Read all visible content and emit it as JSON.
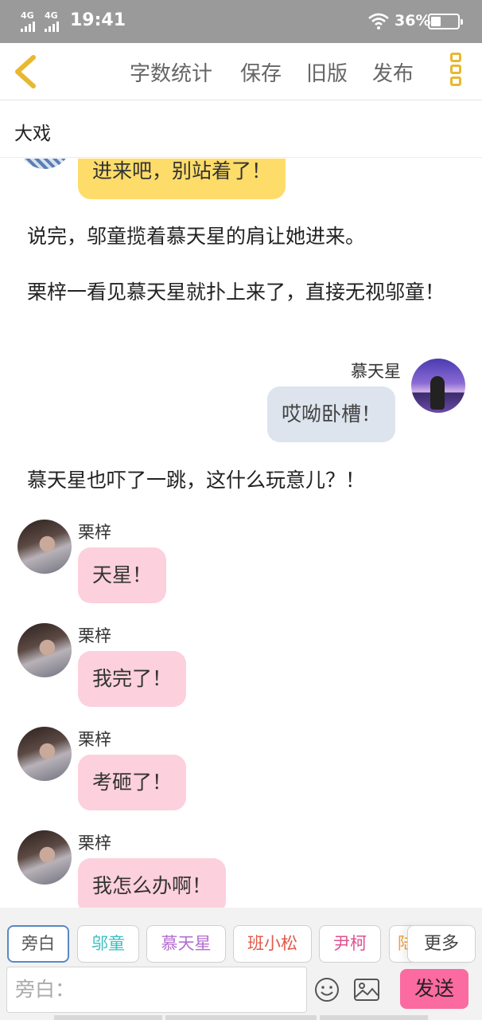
{
  "status_bar": {
    "signal_1": "4G",
    "signal_2": "4G",
    "time": "19:41",
    "battery": "36%"
  },
  "toolbar": {
    "word_count": "字数统计",
    "save": "保存",
    "old_version": "旧版",
    "publish": "发布"
  },
  "story": {
    "title": "大戏"
  },
  "messages": {
    "m0_text": "进来吧，别站着了！",
    "n1": "说完，邬童揽着慕天星的肩让她进来。",
    "n2": "栗梓一看见慕天星就扑上来了，直接无视邬童！",
    "m1_name": "慕天星",
    "m1_text": "哎呦卧槽！",
    "n3": "慕天星也吓了一跳，这什么玩意儿？！",
    "m2_name": "栗梓",
    "m2_text": "天星！",
    "m3_name": "栗梓",
    "m3_text": "我完了！",
    "m4_name": "栗梓",
    "m4_text": "考砸了！",
    "m5_name": "栗梓",
    "m5_text": "我怎么办啊！"
  },
  "characters": {
    "c0": "旁白",
    "c1": "邬童",
    "c2": "慕天星",
    "c3": "班小松",
    "c4": "尹柯",
    "c5": "陆",
    "more": "更多"
  },
  "chip_colors": {
    "c1": "#3bbfbf",
    "c2": "#b36fd0",
    "c3": "#e05a4a",
    "c4": "#e0508f",
    "c5": "#f0a040"
  },
  "composer": {
    "input_placeholder": "旁白：",
    "send": "发送"
  }
}
